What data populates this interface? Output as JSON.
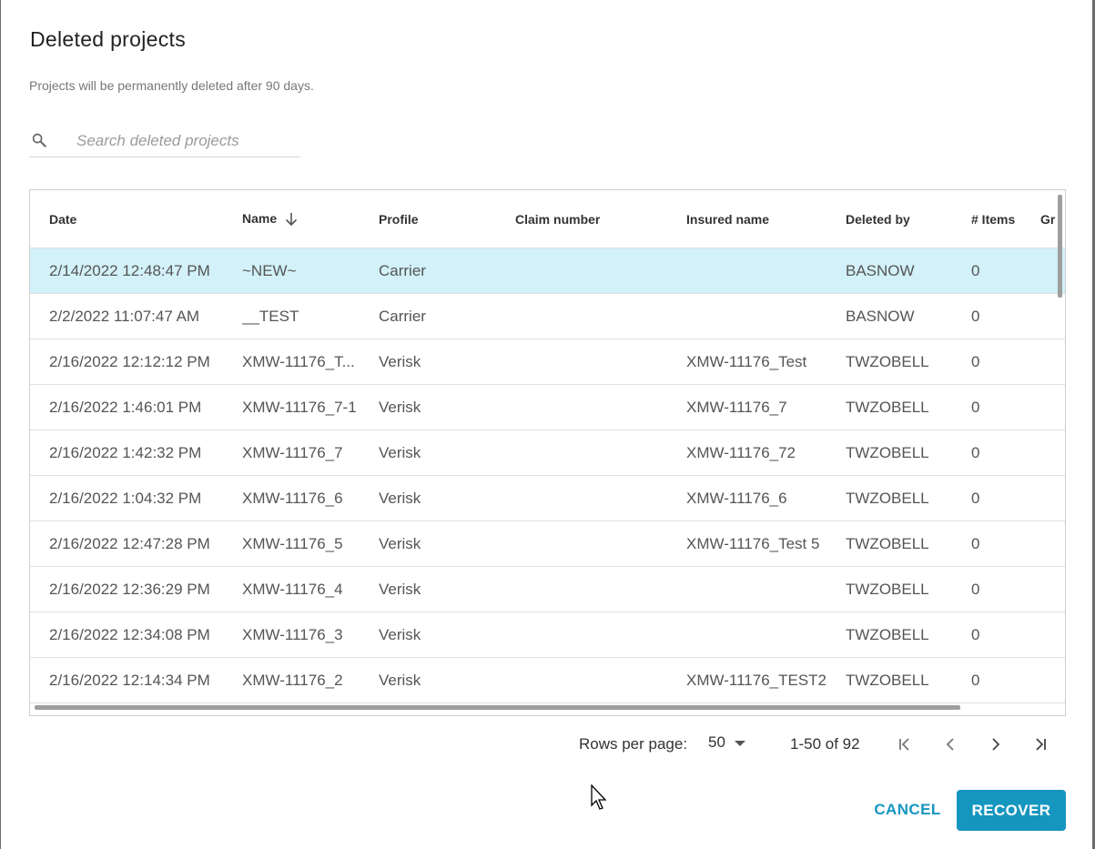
{
  "dialog": {
    "title": "Deleted projects",
    "subtitle": "Projects will be permanently deleted after 90 days."
  },
  "search": {
    "icon": "search-icon",
    "placeholder": "Search deleted projects",
    "value": ""
  },
  "table": {
    "columns": [
      "Date",
      "Name",
      "Profile",
      "Claim number",
      "Insured name",
      "Deleted by",
      "# Items",
      "Gr"
    ],
    "sort": {
      "column": "Name",
      "direction": "descending",
      "icon": "arrow-down-icon"
    },
    "rows": [
      {
        "date": "2/14/2022 12:48:47 PM",
        "name": "~NEW~",
        "profile": "Carrier",
        "claim": "",
        "insured": "",
        "deleted_by": "BASNOW",
        "items": "0",
        "group": "",
        "selected": true
      },
      {
        "date": "2/2/2022 11:07:47 AM",
        "name": "__TEST",
        "profile": "Carrier",
        "claim": "",
        "insured": "",
        "deleted_by": "BASNOW",
        "items": "0",
        "group": ""
      },
      {
        "date": "2/16/2022 12:12:12 PM",
        "name": "XMW-11176_T...",
        "profile": "Verisk",
        "claim": "",
        "insured": "XMW-11176_Test",
        "deleted_by": "TWZOBELL",
        "items": "0",
        "group": ""
      },
      {
        "date": "2/16/2022 1:46:01 PM",
        "name": "XMW-11176_7-1",
        "profile": "Verisk",
        "claim": "",
        "insured": "XMW-11176_7",
        "deleted_by": "TWZOBELL",
        "items": "0",
        "group": ""
      },
      {
        "date": "2/16/2022 1:42:32 PM",
        "name": "XMW-11176_7",
        "profile": "Verisk",
        "claim": "",
        "insured": "XMW-11176_72",
        "deleted_by": "TWZOBELL",
        "items": "0",
        "group": ""
      },
      {
        "date": "2/16/2022 1:04:32 PM",
        "name": "XMW-11176_6",
        "profile": "Verisk",
        "claim": "",
        "insured": "XMW-11176_6",
        "deleted_by": "TWZOBELL",
        "items": "0",
        "group": ""
      },
      {
        "date": "2/16/2022 12:47:28 PM",
        "name": "XMW-11176_5",
        "profile": "Verisk",
        "claim": "",
        "insured": "XMW-11176_Test 5",
        "deleted_by": "TWZOBELL",
        "items": "0",
        "group": ""
      },
      {
        "date": "2/16/2022 12:36:29 PM",
        "name": "XMW-11176_4",
        "profile": "Verisk",
        "claim": "",
        "insured": "",
        "deleted_by": "TWZOBELL",
        "items": "0",
        "group": ""
      },
      {
        "date": "2/16/2022 12:34:08 PM",
        "name": "XMW-11176_3",
        "profile": "Verisk",
        "claim": "",
        "insured": "",
        "deleted_by": "TWZOBELL",
        "items": "0",
        "group": ""
      },
      {
        "date": "2/16/2022 12:14:34 PM",
        "name": "XMW-11176_2",
        "profile": "Verisk",
        "claim": "",
        "insured": "XMW-11176_TEST2",
        "deleted_by": "TWZOBELL",
        "items": "0",
        "group": ""
      }
    ]
  },
  "pagination": {
    "rows_per_page_label": "Rows per page:",
    "rows_per_page_value": "50",
    "range_text": "1-50 of 92",
    "icons": [
      "first-page-icon",
      "previous-page-icon",
      "next-page-icon",
      "last-page-icon"
    ]
  },
  "actions": {
    "cancel_label": "CANCEL",
    "recover_label": "RECOVER"
  },
  "colors": {
    "accent": "#1596bf",
    "selected_row": "#d2f1f8",
    "text": "#555555"
  }
}
